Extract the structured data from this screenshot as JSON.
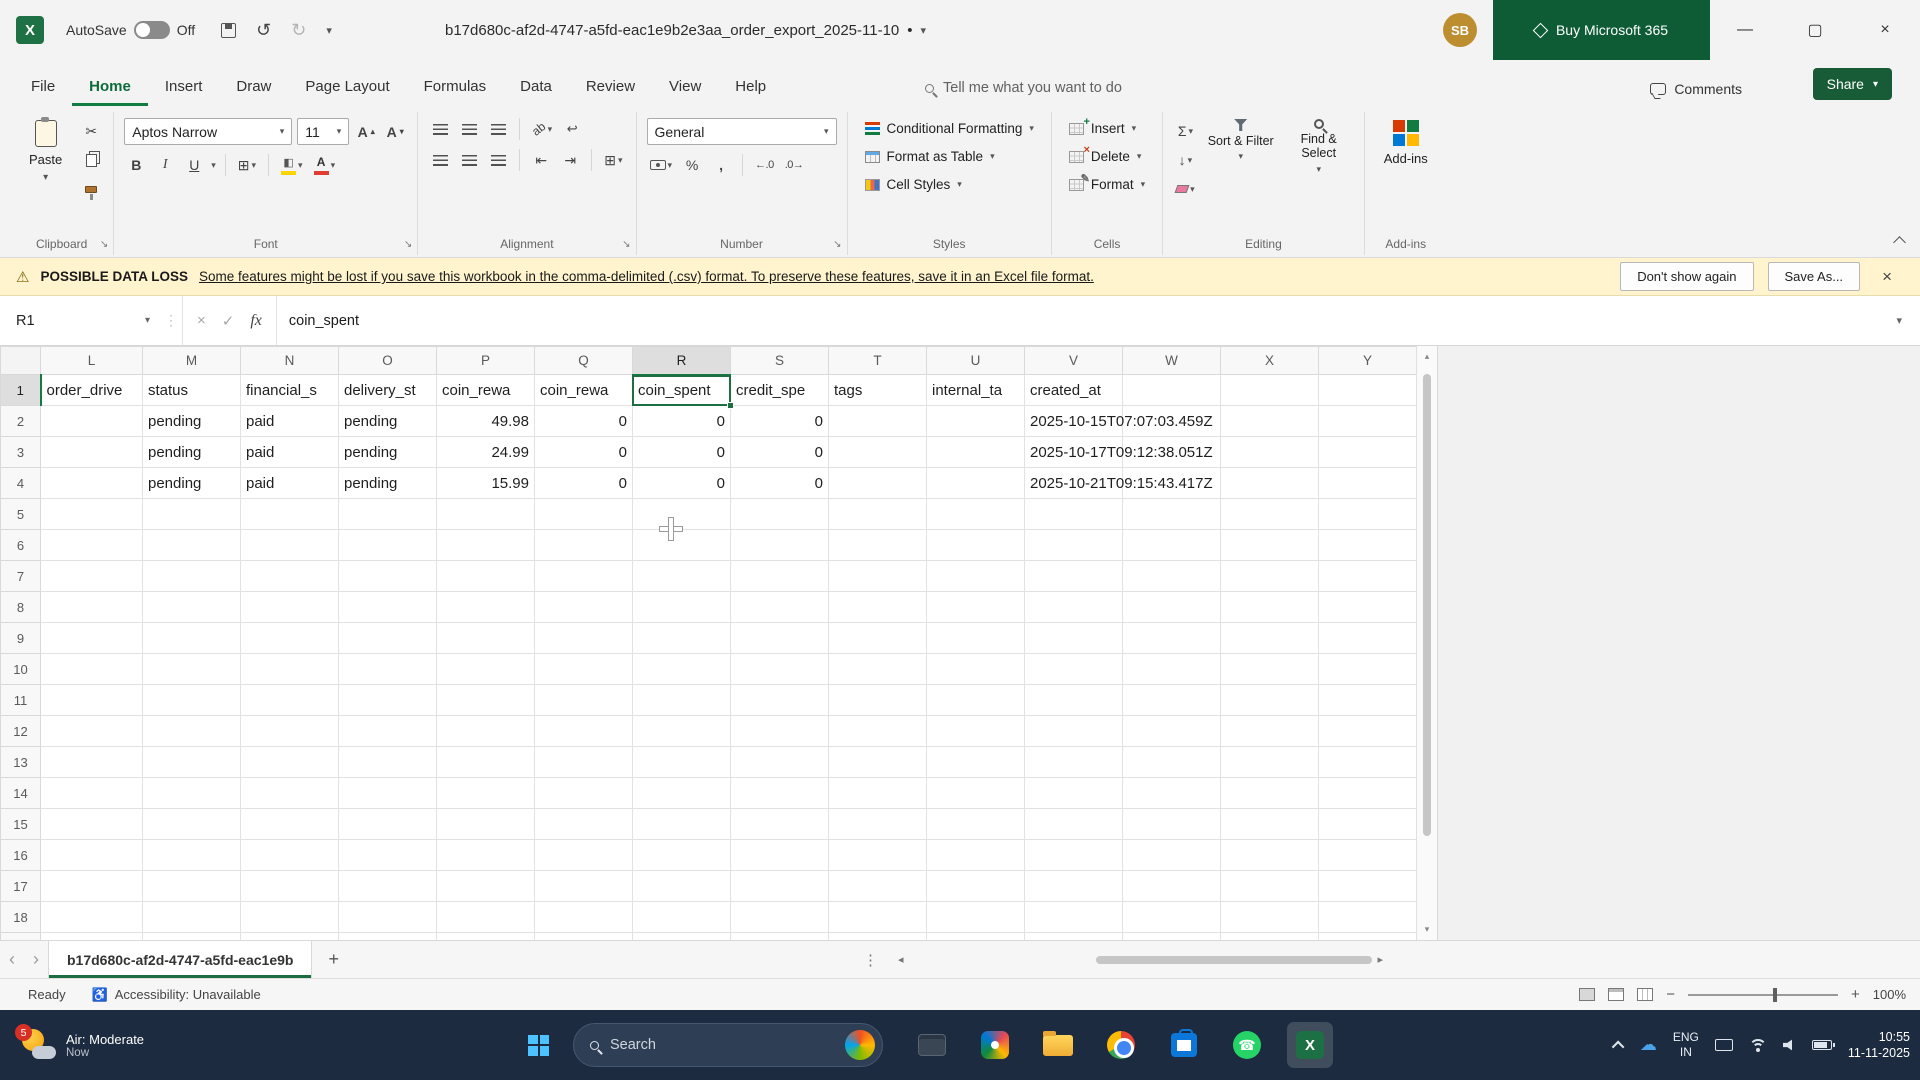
{
  "titlebar": {
    "autosave_label": "AutoSave",
    "autosave_state": "Off",
    "document_title": "b17d680c-af2d-4747-a5fd-eac1e9b2e3aa_order_export_2025-11-10",
    "modified_indicator": "•",
    "avatar_initials": "SB",
    "buy_button_label": "Buy Microsoft 365"
  },
  "ribbon_tabs": {
    "items": [
      "File",
      "Home",
      "Insert",
      "Draw",
      "Page Layout",
      "Formulas",
      "Data",
      "Review",
      "View",
      "Help"
    ],
    "active": "Home",
    "tell_me_label": "Tell me what you want to do",
    "comments_label": "Comments",
    "share_label": "Share"
  },
  "ribbon": {
    "paste_label": "Paste",
    "clipboard_group_label": "Clipboard",
    "font_name": "Aptos Narrow",
    "font_size": "11",
    "bold_label": "B",
    "italic_label": "I",
    "underline_label": "U",
    "font_group_label": "Font",
    "alignment_group_label": "Alignment",
    "number_format": "General",
    "number_group_label": "Number",
    "conditional_formatting_label": "Conditional Formatting",
    "format_as_table_label": "Format as Table",
    "cell_styles_label": "Cell Styles",
    "styles_group_label": "Styles",
    "insert_label": "Insert",
    "delete_label": "Delete",
    "format_label": "Format",
    "cells_group_label": "Cells",
    "autosum_label": "Σ",
    "sort_filter_label": "Sort & Filter",
    "find_select_label": "Find & Select",
    "editing_group_label": "Editing",
    "addins_label": "Add-ins",
    "addins_group_label": "Add-ins"
  },
  "warning_bar": {
    "title": "POSSIBLE DATA LOSS",
    "message": "Some features might be lost if you save this workbook in the comma-delimited (.csv) format. To preserve these features, save it in an Excel file format.",
    "dont_show_label": "Don't show again",
    "save_as_label": "Save As..."
  },
  "formula_bar": {
    "name_box": "R1",
    "fx_label": "fx",
    "content": "coin_spent"
  },
  "grid": {
    "columns": [
      "L",
      "M",
      "N",
      "O",
      "P",
      "Q",
      "R",
      "S",
      "T",
      "U",
      "V",
      "W",
      "X",
      "Y"
    ],
    "visible_rows": 19,
    "selected": {
      "col": "R",
      "row": 1
    },
    "rows": {
      "1": {
        "L": "order_drive",
        "M": "status",
        "N": "financial_s",
        "O": "delivery_st",
        "P": "coin_rewa",
        "Q": "coin_rewa",
        "R": "coin_spent",
        "S": "credit_spe",
        "T": "tags",
        "U": "internal_ta",
        "V": "created_at"
      },
      "2": {
        "M": "pending",
        "N": "paid",
        "O": "pending",
        "P": "49.98",
        "Q": "0",
        "R": "0",
        "S": "0",
        "V": "2025-10-15T07:07:03.459Z"
      },
      "3": {
        "M": "pending",
        "N": "paid",
        "O": "pending",
        "P": "24.99",
        "Q": "0",
        "R": "0",
        "S": "0",
        "V": "2025-10-17T09:12:38.051Z"
      },
      "4": {
        "M": "pending",
        "N": "paid",
        "O": "pending",
        "P": "15.99",
        "Q": "0",
        "R": "0",
        "S": "0",
        "V": "2025-10-21T09:15:43.417Z"
      }
    }
  },
  "sheet_bar": {
    "active_sheet": "b17d680c-af2d-4747-a5fd-eac1e9b"
  },
  "status_bar": {
    "mode": "Ready",
    "accessibility": "Accessibility: Unavailable",
    "zoom": "100%"
  },
  "taskbar": {
    "weather_title": "Air: Moderate",
    "weather_subtitle": "Now",
    "weather_badge": "5",
    "search_label": "Search",
    "apps": [
      "app-window",
      "photos",
      "file-explorer",
      "chrome",
      "store",
      "whatsapp",
      "excel"
    ],
    "active_app": "excel",
    "language_top": "ENG",
    "language_bottom": "IN",
    "time": "10:55",
    "date": "11-11-2025"
  }
}
